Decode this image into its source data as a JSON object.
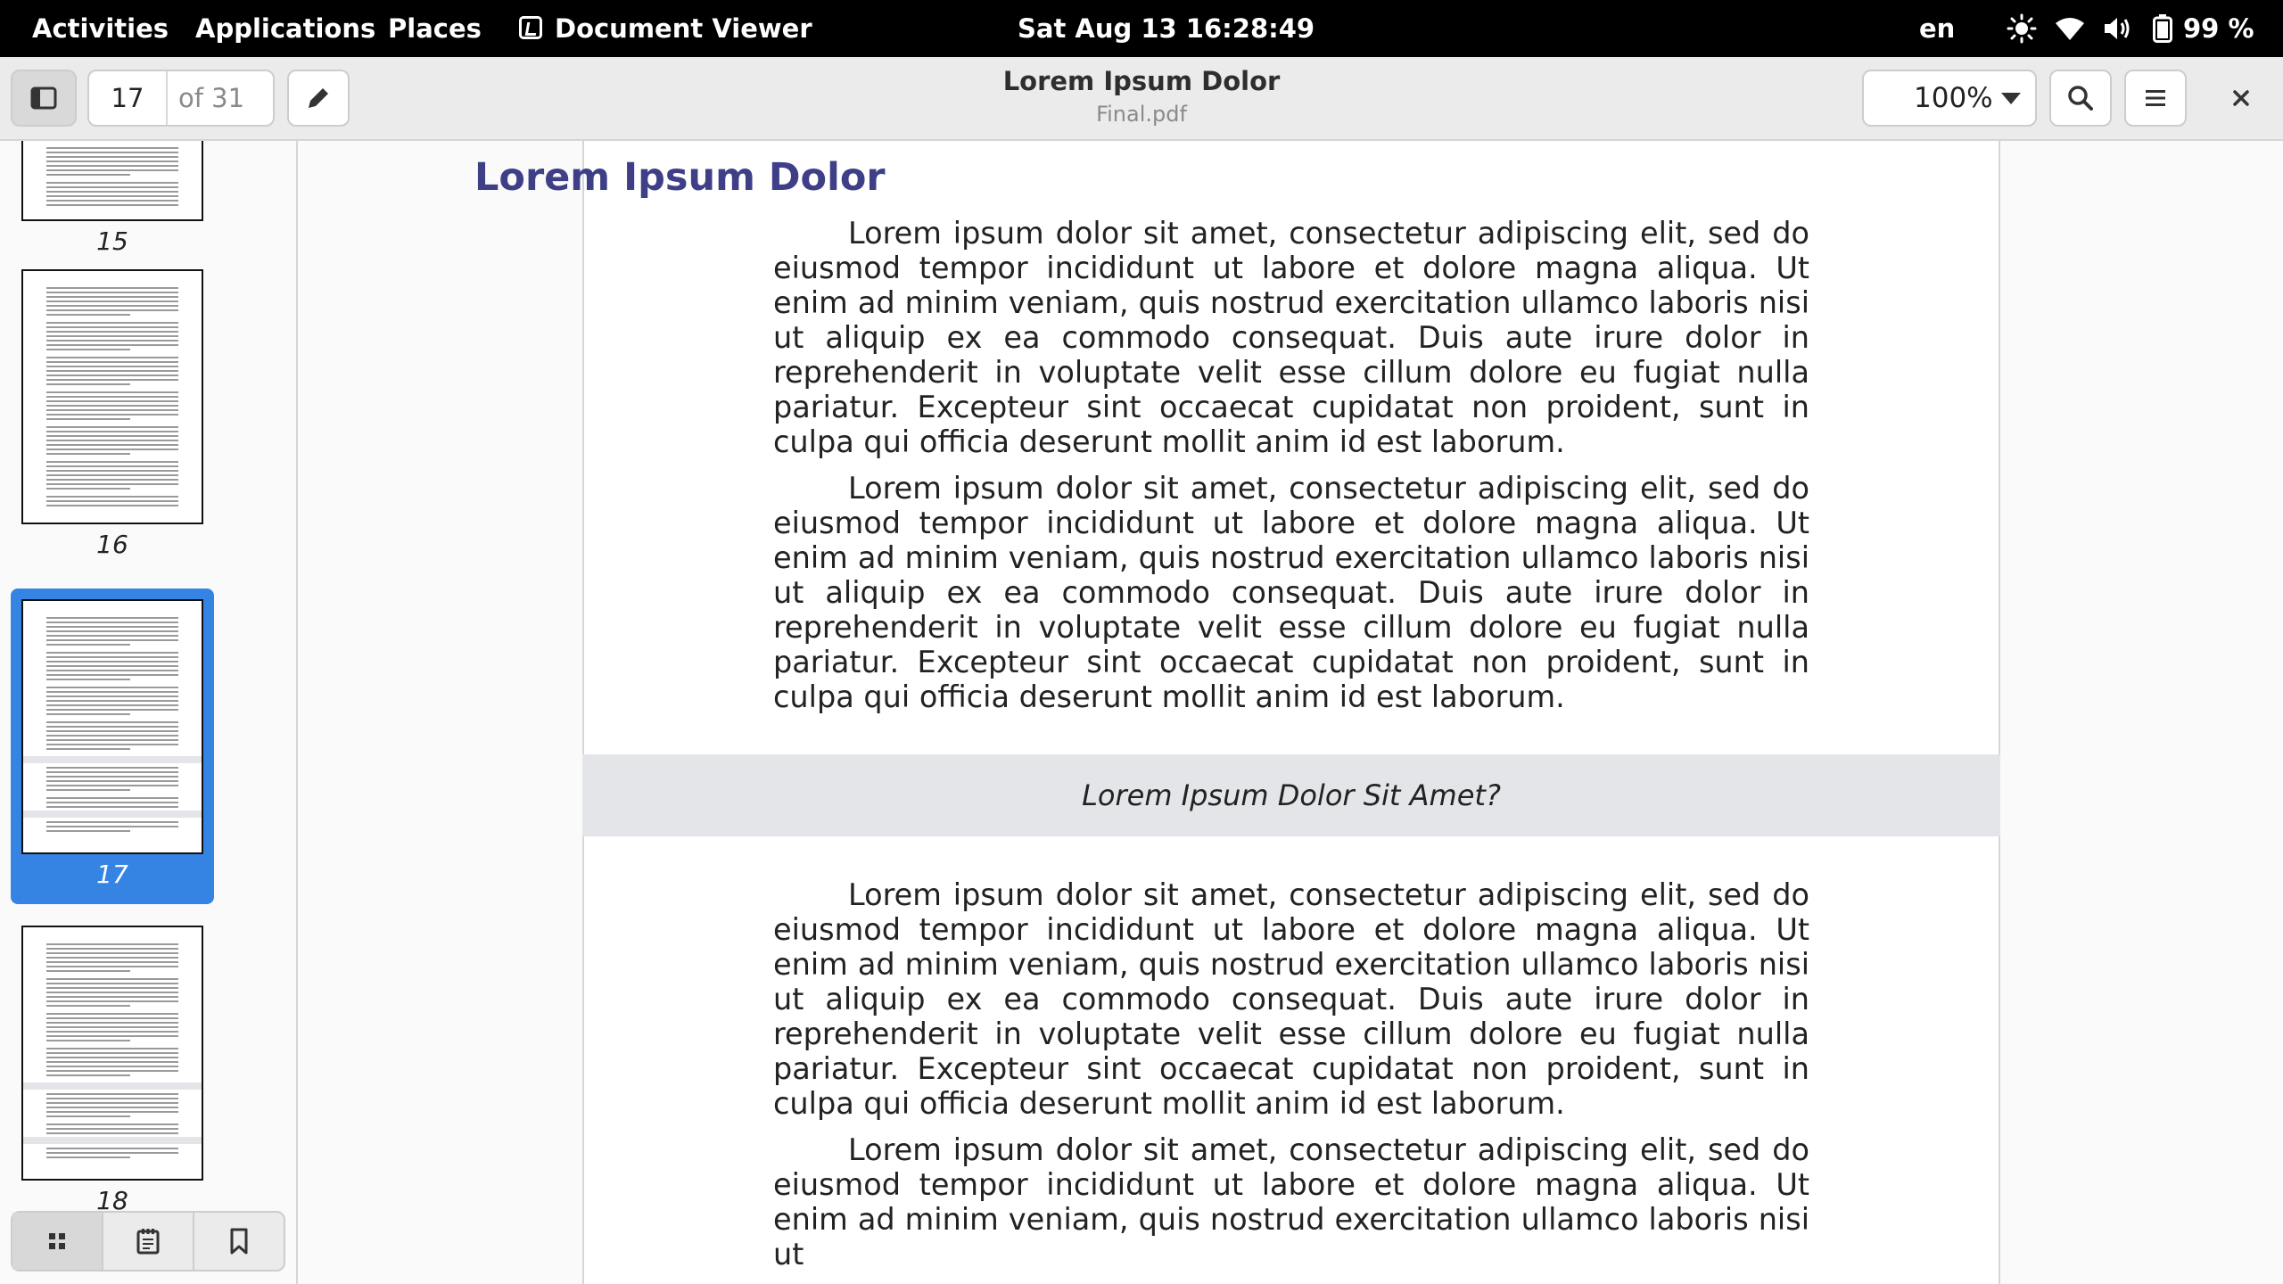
{
  "topbar": {
    "activities": "Activities",
    "applications": "Applications",
    "places": "Places",
    "app_name": "Document Viewer",
    "clock": "Sat Aug 13  16:28:49",
    "keyboard_layout": "en",
    "battery": "99 %"
  },
  "header": {
    "current_page": "17",
    "page_total": "of 31",
    "title": "Lorem Ipsum Dolor",
    "subtitle": "Final.pdf",
    "zoom": "100%"
  },
  "sidebar": {
    "thumbnails": [
      {
        "page": "15",
        "selected": false
      },
      {
        "page": "16",
        "selected": false
      },
      {
        "page": "17",
        "selected": true
      },
      {
        "page": "18",
        "selected": false
      }
    ]
  },
  "document": {
    "heading": "Lorem Ipsum Dolor",
    "paragraphs": [
      "Lorem ipsum dolor sit amet, consectetur adipiscing elit, sed do eiusmod tempor incididunt ut labore et dolore magna aliqua. Ut enim ad minim veniam, quis nostrud exercitation ullamco laboris nisi ut aliquip ex ea commodo consequat. Duis aute irure dolor in reprehenderit in voluptate velit esse cillum dolore eu fugiat nulla pariatur. Excepteur sint occaecat cupidatat non proident, sunt in culpa qui officia deserunt mollit anim id est laborum.",
      "Lorem ipsum dolor sit amet, consectetur adipiscing elit, sed do eiusmod tempor incididunt ut labore et dolore magna aliqua. Ut enim ad minim veniam, quis nostrud exercitation ullamco laboris nisi ut aliquip ex ea commodo consequat. Duis aute irure dolor in reprehenderit in voluptate velit esse cillum dolore eu fugiat nulla pariatur. Excepteur sint occaecat cupidatat non proident, sunt in culpa qui officia deserunt mollit anim id est laborum.",
      "Lorem ipsum dolor sit amet, consectetur adipiscing elit, sed do eiusmod tempor incididunt ut labore et dolore magna aliqua. Ut enim ad minim veniam, quis nostrud exercitation ullamco laboris nisi ut aliquip ex ea commodo consequat. Duis aute irure dolor in reprehenderit in voluptate velit esse cillum dolore eu fugiat nulla pariatur. Excepteur sint occaecat cupidatat non proident, sunt in culpa qui officia deserunt mollit anim id est laborum.",
      "Lorem ipsum dolor sit amet, consectetur adipiscing elit, sed do eiusmod tempor incididunt ut labore et dolore magna aliqua. Ut enim ad minim veniam, quis nostrud exercitation ullamco laboris nisi ut"
    ],
    "callout": "Lorem Ipsum Dolor Sit Amet?"
  },
  "colors": {
    "heading": "#3f3f88",
    "selection": "#3584e4",
    "callout_band": "#e4e5e8"
  },
  "icons": [
    "app-icon",
    "brightness-icon",
    "wifi-icon",
    "volume-icon",
    "battery-icon",
    "sidebar-toggle-icon",
    "pencil-icon",
    "search-icon",
    "menu-icon",
    "close-icon",
    "grid-icon",
    "outline-icon",
    "bookmark-icon"
  ]
}
